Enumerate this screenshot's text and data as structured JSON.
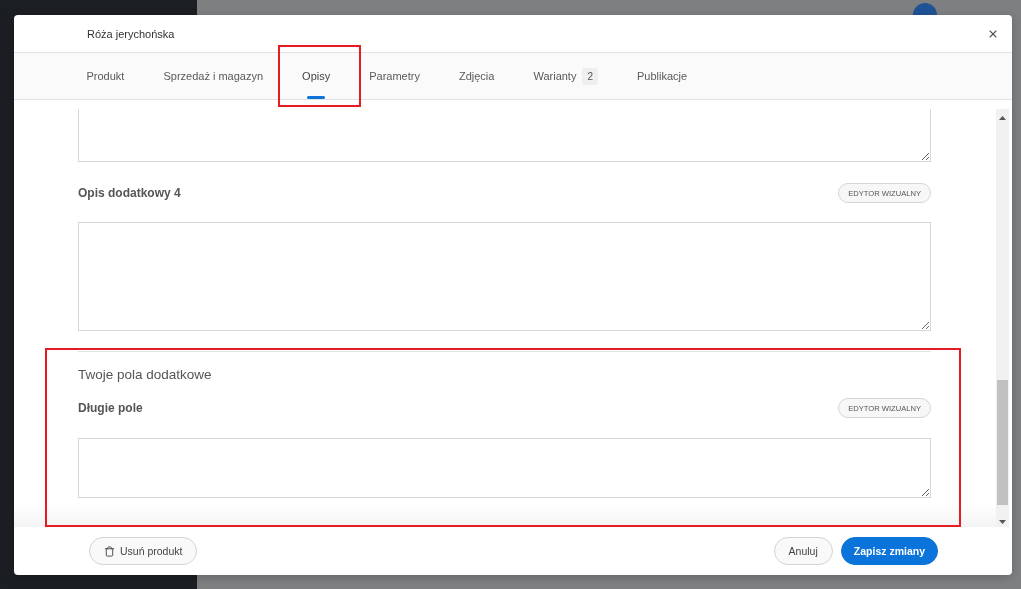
{
  "dialog": {
    "title": "Róża jerychońska"
  },
  "tabs": [
    {
      "label": "Produkt",
      "selected": false,
      "highlighted": false
    },
    {
      "label": "Sprzedaż i magazyn",
      "selected": false,
      "highlighted": false
    },
    {
      "label": "Opisy",
      "selected": true,
      "highlighted": true
    },
    {
      "label": "Parametry",
      "selected": false,
      "highlighted": false
    },
    {
      "label": "Zdjęcia",
      "selected": false,
      "highlighted": false
    },
    {
      "label": "Warianty",
      "badge": "2",
      "selected": false,
      "highlighted": false
    },
    {
      "label": "Publikacje",
      "selected": false,
      "highlighted": false
    }
  ],
  "descriptions": [
    {
      "kind": "cut-off"
    },
    {
      "kind": "editor",
      "label": "Opis dodatkowy 4",
      "button": "EDYTOR WIZUALNY"
    }
  ],
  "custom_fields": {
    "heading": "Twoje pola dodatkowe",
    "highlighted": true,
    "fields": [
      {
        "kind": "editor",
        "label": "Długie pole",
        "button": "EDYTOR WIZUALNY"
      }
    ]
  },
  "footer": {
    "buttons": [
      {
        "kind": "delete",
        "label": "Usuń produkt"
      },
      {
        "kind": "secondary",
        "label": "Anuluj"
      },
      {
        "kind": "primary",
        "label": "Zapisz zmiany"
      }
    ]
  }
}
